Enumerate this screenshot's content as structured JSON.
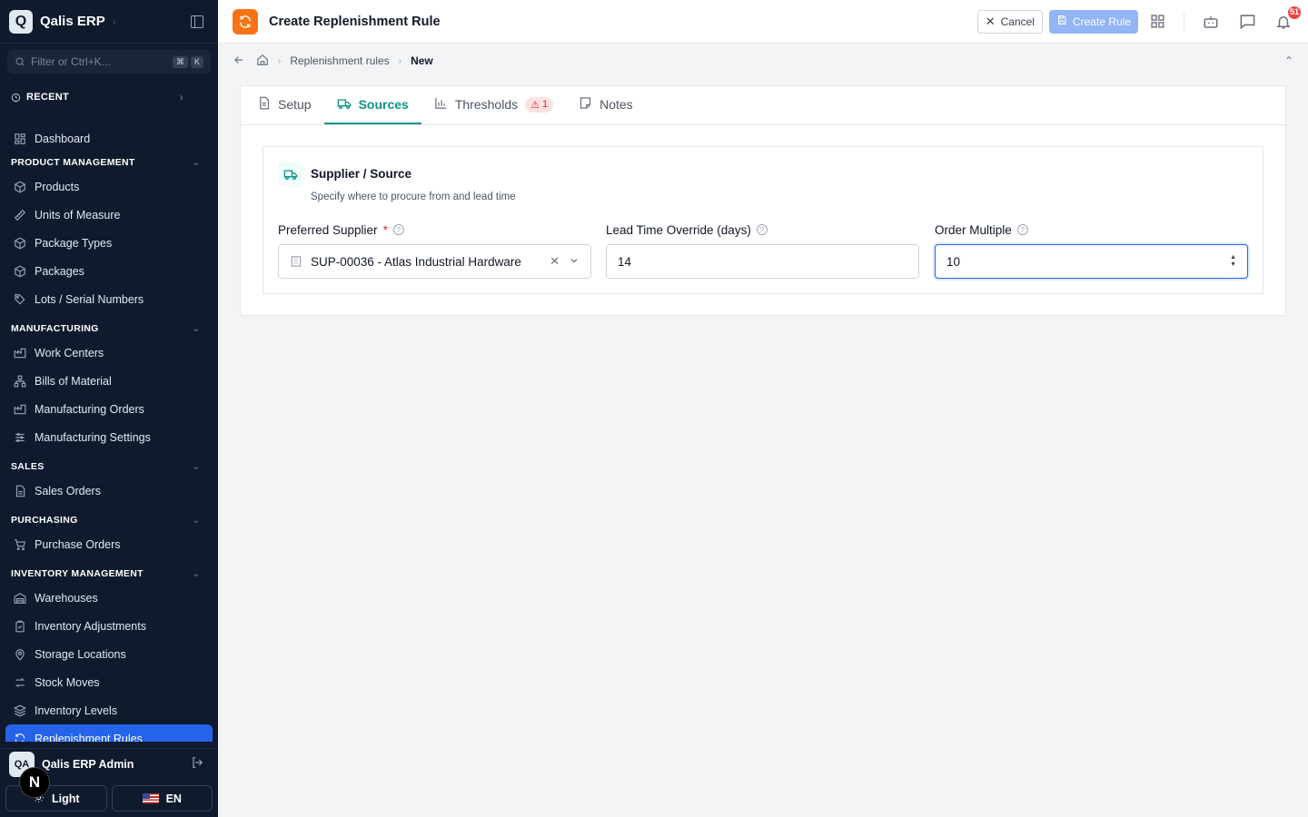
{
  "app": {
    "name": "Qalis ERP"
  },
  "sidebar": {
    "filter_placeholder": "Filter or Ctrl+K...",
    "kbd": [
      "⌘",
      "K"
    ],
    "recent_label": "RECENT",
    "dashboard": "Dashboard",
    "sections": [
      {
        "title": "PRODUCT MANAGEMENT",
        "items": [
          "Products",
          "Units of Measure",
          "Package Types",
          "Packages",
          "Lots / Serial Numbers"
        ]
      },
      {
        "title": "MANUFACTURING",
        "items": [
          "Work Centers",
          "Bills of Material",
          "Manufacturing Orders",
          "Manufacturing Settings"
        ]
      },
      {
        "title": "SALES",
        "items": [
          "Sales Orders"
        ]
      },
      {
        "title": "PURCHASING",
        "items": [
          "Purchase Orders"
        ]
      },
      {
        "title": "INVENTORY MANAGEMENT",
        "items": [
          "Warehouses",
          "Inventory Adjustments",
          "Storage Locations",
          "Stock Moves",
          "Inventory Levels",
          "Replenishment Rules"
        ]
      }
    ],
    "active_item": "Replenishment Rules",
    "user": {
      "initials": "QA",
      "name": "Qalis ERP Admin"
    },
    "theme_label": "Light",
    "lang_label": "EN",
    "n_badge": "N"
  },
  "topbar": {
    "title": "Create Replenishment Rule",
    "cancel_label": "Cancel",
    "create_label": "Create Rule",
    "notification_count": "51"
  },
  "breadcrumb": {
    "items": [
      "Replenishment rules",
      "New"
    ]
  },
  "tabs": [
    {
      "label": "Setup"
    },
    {
      "label": "Sources"
    },
    {
      "label": "Thresholds",
      "badge": "1"
    },
    {
      "label": "Notes"
    }
  ],
  "active_tab": "Sources",
  "section": {
    "title": "Supplier / Source",
    "subtitle": "Specify where to procure from and lead time"
  },
  "fields": {
    "supplier": {
      "label": "Preferred Supplier",
      "required": "*",
      "value": "SUP-00036 - Atlas Industrial Hardware"
    },
    "lead_time": {
      "label": "Lead Time Override (days)",
      "value": "14"
    },
    "order_multiple": {
      "label": "Order Multiple",
      "value": "10"
    }
  },
  "colors": {
    "accent": "#0d9488",
    "sidebar_bg": "#0f1b2d",
    "active_nav": "#2563eb",
    "brand_icon": "#f97316",
    "notification": "#ef4444"
  }
}
